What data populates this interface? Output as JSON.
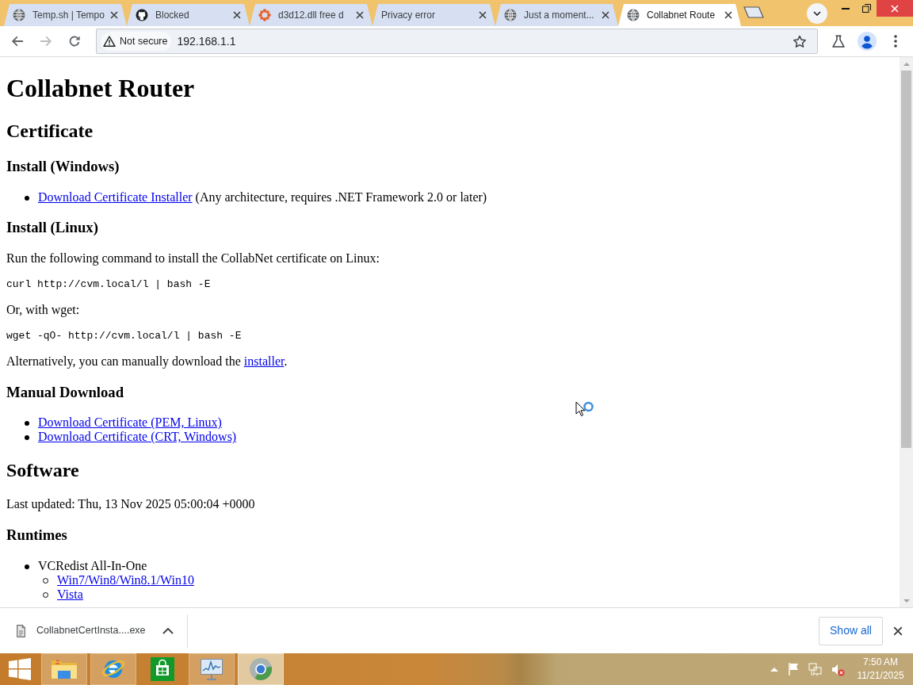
{
  "browser": {
    "tabs": [
      {
        "title": "Temp.sh | Tempo",
        "selected": false
      },
      {
        "title": "Blocked",
        "selected": false
      },
      {
        "title": "d3d12.dll free d",
        "selected": false
      },
      {
        "title": "Privacy error",
        "selected": false
      },
      {
        "title": "Just a moment...",
        "selected": false
      },
      {
        "title": "Collabnet Route",
        "selected": true
      }
    ],
    "back_button": {
      "disabled": false
    },
    "forward_button": {
      "disabled": true
    },
    "address_bar": {
      "security_label": "Not secure",
      "url": "192.168.1.1"
    }
  },
  "page": {
    "blocks": [
      {
        "kind": "heading1",
        "text": "Collabnet Router"
      },
      {
        "kind": "heading2",
        "text": "Certificate"
      },
      {
        "kind": "heading3",
        "text": "Install (Windows)"
      },
      {
        "kind": "list",
        "items": [
          {
            "parts": [
              {
                "kind": "link",
                "text": "Download Certificate Installer"
              },
              {
                "kind": "text",
                "text": " (Any architecture, requires .NET Framework 2.0 or later)"
              }
            ]
          }
        ]
      },
      {
        "kind": "heading3",
        "text": "Install (Linux)"
      },
      {
        "kind": "paragraph",
        "parts": [
          {
            "kind": "text",
            "text": "Run the following command to install the CollabNet certificate on Linux:"
          }
        ]
      },
      {
        "kind": "code",
        "text": "curl http://cvm.local/l | bash -E"
      },
      {
        "kind": "paragraph",
        "parts": [
          {
            "kind": "text",
            "text": "Or, with wget:"
          }
        ]
      },
      {
        "kind": "code",
        "text": "wget -qO- http://cvm.local/l | bash -E"
      },
      {
        "kind": "paragraph",
        "parts": [
          {
            "kind": "text",
            "text": "Alternatively, you can manually download the "
          },
          {
            "kind": "link",
            "text": "installer"
          },
          {
            "kind": "text",
            "text": "."
          }
        ]
      },
      {
        "kind": "heading3",
        "text": "Manual Download"
      },
      {
        "kind": "list",
        "items": [
          {
            "parts": [
              {
                "kind": "link",
                "text": "Download Certificate (PEM, Linux)"
              }
            ]
          },
          {
            "parts": [
              {
                "kind": "link",
                "text": "Download Certificate (CRT, Windows)"
              }
            ]
          }
        ]
      },
      {
        "kind": "heading2",
        "text": "Software"
      },
      {
        "kind": "paragraph",
        "parts": [
          {
            "kind": "text",
            "text": "Last updated: Thu, 13 Nov 2025 05:00:04 +0000"
          }
        ]
      },
      {
        "kind": "heading3",
        "text": "Runtimes"
      },
      {
        "kind": "list",
        "items": [
          {
            "parts": [
              {
                "kind": "text",
                "text": "VCRedist All-In-One"
              }
            ],
            "children": [
              {
                "parts": [
                  {
                    "kind": "link",
                    "text": "Win7/Win8/Win8.1/Win10"
                  }
                ]
              },
              {
                "parts": [
                  {
                    "kind": "link",
                    "text": "Vista"
                  }
                ]
              }
            ]
          }
        ]
      }
    ]
  },
  "download_shelf": {
    "items": [
      {
        "file_name": "CollabnetCertInsta....exe"
      }
    ],
    "show_all_label": "Show all"
  },
  "taskbar": {
    "apps": [
      {
        "running": true,
        "selected": false
      },
      {
        "running": true,
        "selected": false
      },
      {
        "running": false,
        "selected": false
      },
      {
        "running": true,
        "selected": false
      },
      {
        "running": true,
        "selected": true
      }
    ],
    "clock": {
      "time": "7:50 AM",
      "date": "11/21/2025"
    }
  }
}
